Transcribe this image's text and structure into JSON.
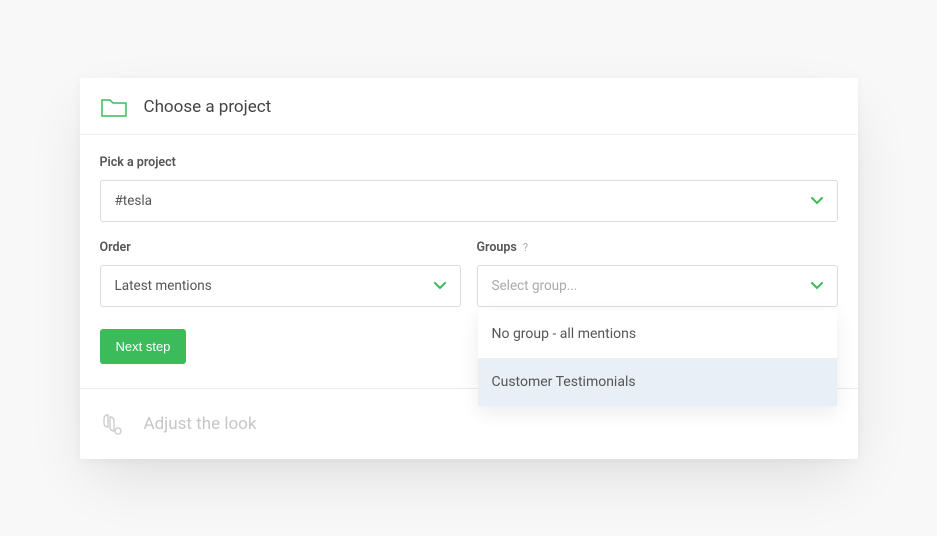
{
  "step1": {
    "title": "Choose a project",
    "pick_label": "Pick a project",
    "project_value": "#tesla",
    "order_label": "Order",
    "order_value": "Latest mentions",
    "groups_label": "Groups",
    "groups_help": "?",
    "groups_placeholder": "Select group...",
    "groups_options": [
      "No group - all mentions",
      "Customer Testimonials"
    ],
    "next_button": "Next step"
  },
  "step2": {
    "title": "Adjust the look"
  }
}
